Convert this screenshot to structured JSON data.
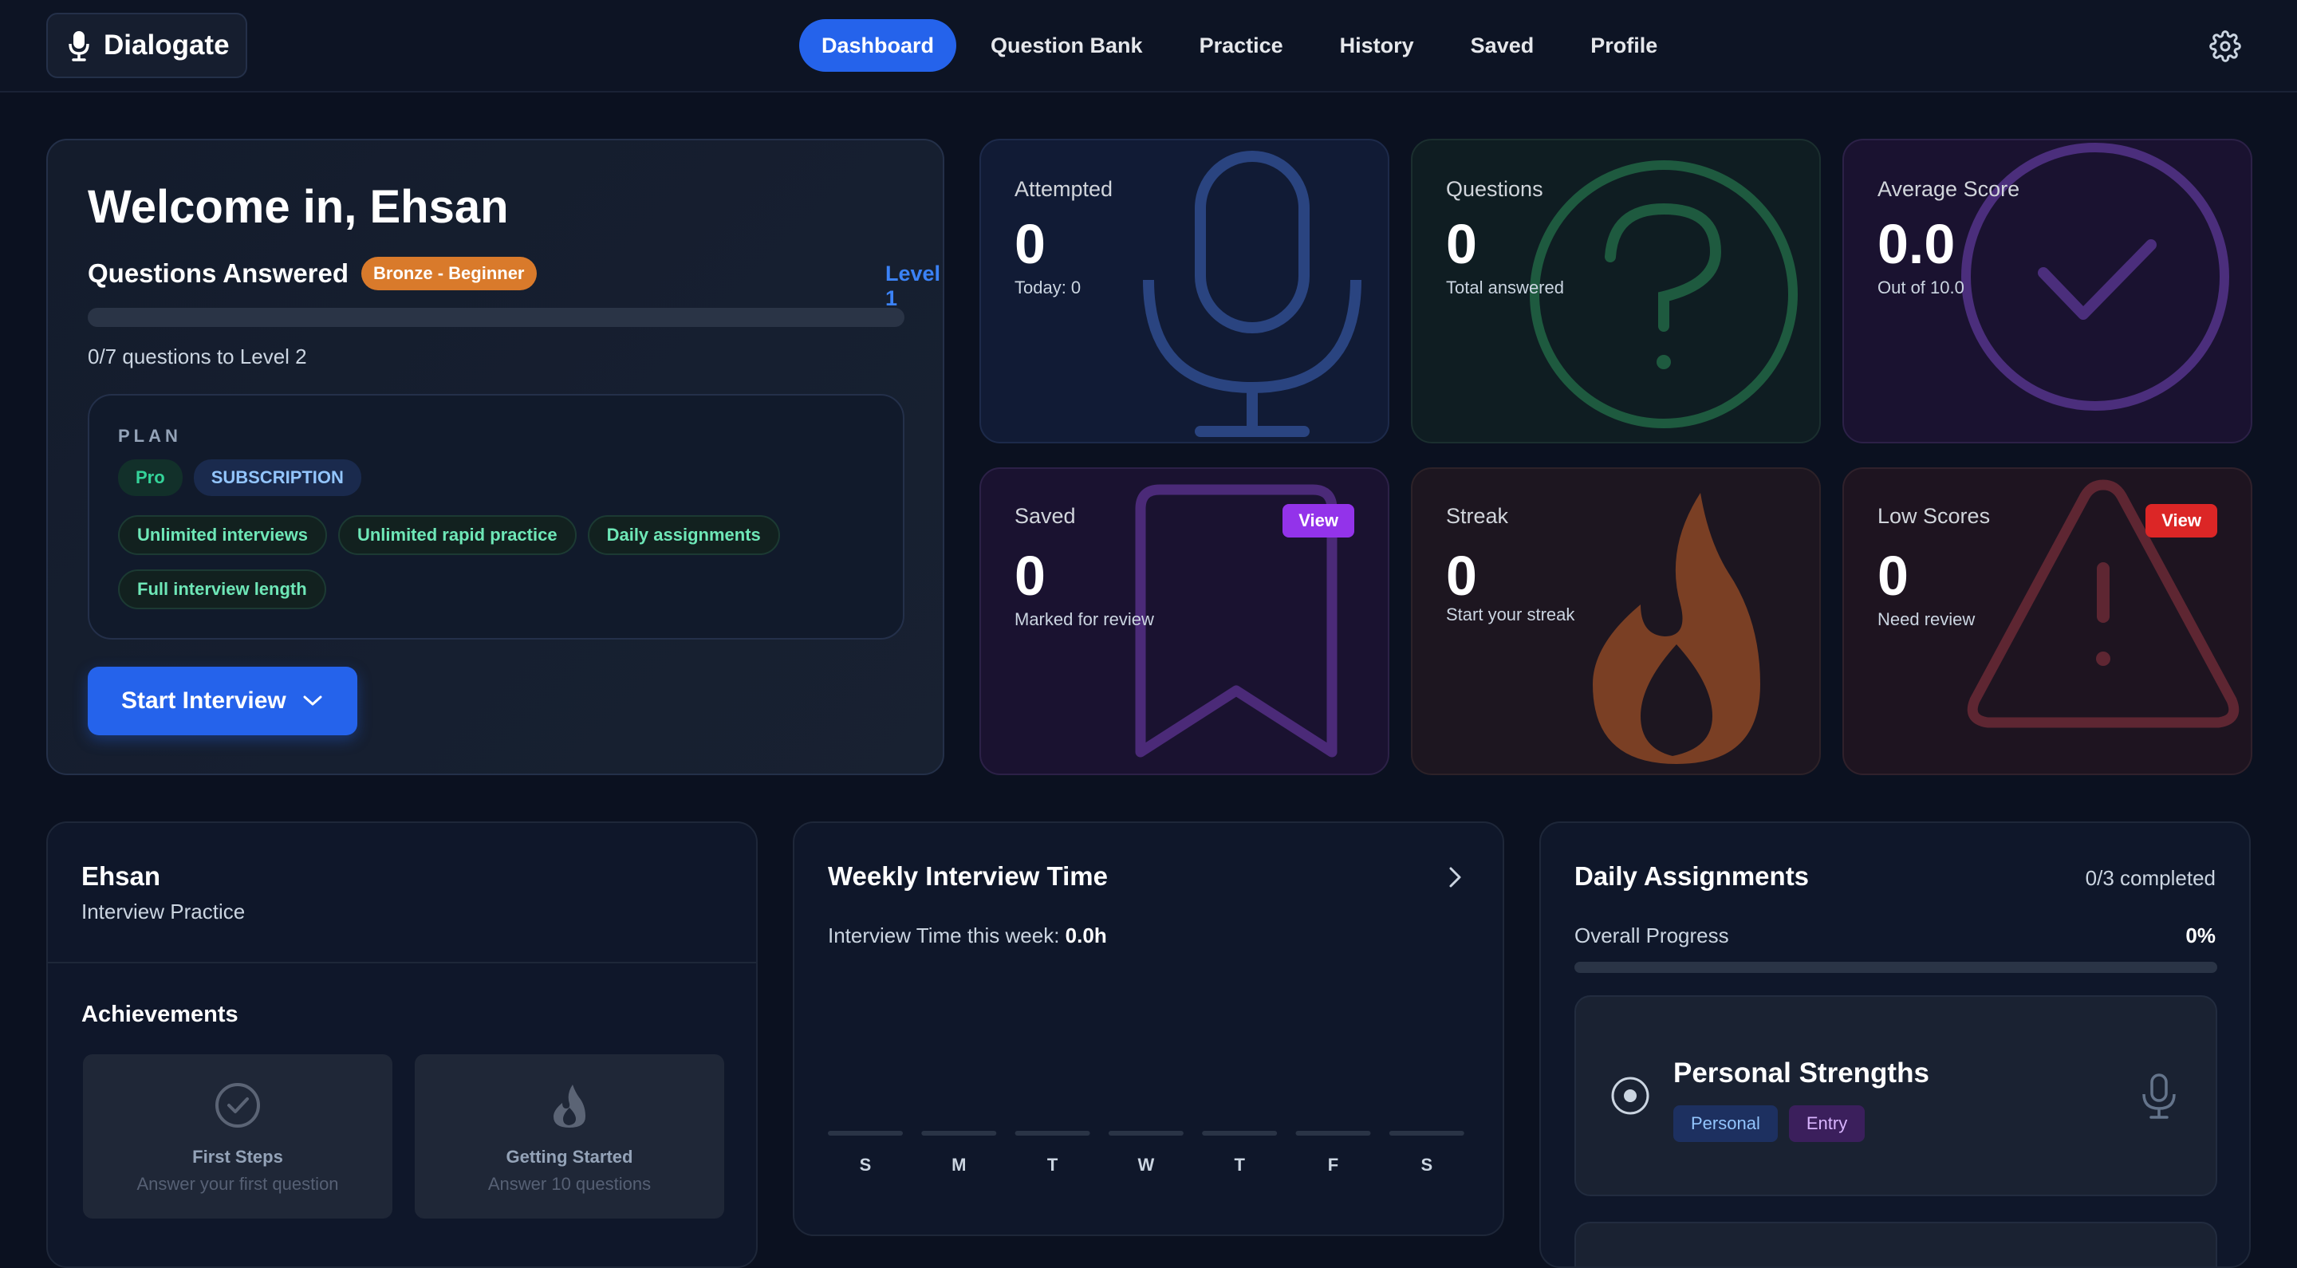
{
  "app": {
    "name": "Dialogate"
  },
  "nav": {
    "items": [
      {
        "label": "Dashboard",
        "active": true
      },
      {
        "label": "Question Bank",
        "active": false
      },
      {
        "label": "Practice",
        "active": false
      },
      {
        "label": "History",
        "active": false
      },
      {
        "label": "Saved",
        "active": false
      },
      {
        "label": "Profile",
        "active": false
      }
    ]
  },
  "welcome": {
    "title": "Welcome in, Ehsan",
    "questions_answered_label": "Questions Answered",
    "tier_badge": "Bronze - Beginner",
    "level_label": "Level 1",
    "progress_fraction": 0,
    "progress_caption": "0/7 questions to Level 2",
    "plan": {
      "label": "PLAN",
      "tier": "Pro",
      "type": "SUBSCRIPTION",
      "features": [
        "Unlimited interviews",
        "Unlimited rapid practice",
        "Daily assignments",
        "Full interview length"
      ]
    },
    "start_button": "Start Interview"
  },
  "stats": {
    "attempted": {
      "title": "Attempted",
      "value": "0",
      "sub": "Today: 0"
    },
    "questions": {
      "title": "Questions",
      "value": "0",
      "sub": "Total answered"
    },
    "average": {
      "title": "Average Score",
      "value": "0.0",
      "sub": "Out of 10.0"
    },
    "saved": {
      "title": "Saved",
      "value": "0",
      "sub": "Marked for review",
      "button": "View"
    },
    "streak": {
      "title": "Streak",
      "value": "0",
      "sub": "Start your streak"
    },
    "low": {
      "title": "Low Scores",
      "value": "0",
      "sub": "Need review",
      "button": "View"
    }
  },
  "profile": {
    "name": "Ehsan",
    "subtitle": "Interview Practice",
    "achievements_title": "Achievements",
    "achievements": [
      {
        "name": "First Steps",
        "desc": "Answer your first question"
      },
      {
        "name": "Getting Started",
        "desc": "Answer 10 questions"
      }
    ]
  },
  "weekly": {
    "title": "Weekly Interview Time",
    "subtitle_label": "Interview Time this week:",
    "subtitle_value": "0.0h"
  },
  "chart_data": {
    "type": "bar",
    "categories": [
      "S",
      "M",
      "T",
      "W",
      "T",
      "F",
      "S"
    ],
    "values": [
      0,
      0,
      0,
      0,
      0,
      0,
      0
    ],
    "title": "Weekly Interview Time",
    "xlabel": "",
    "ylabel": "",
    "grid": false
  },
  "daily": {
    "title": "Daily Assignments",
    "count": "0/3 completed",
    "progress_label": "Overall Progress",
    "progress_pct": "0%",
    "progress_fraction": 0,
    "assignment": {
      "name": "Personal Strengths",
      "tags": [
        "Personal",
        "Entry"
      ]
    }
  },
  "colors": {
    "accent": "#2563eb",
    "bronze": "#d97a2b",
    "view_purple": "#9333ea",
    "view_red": "#dc2626"
  }
}
